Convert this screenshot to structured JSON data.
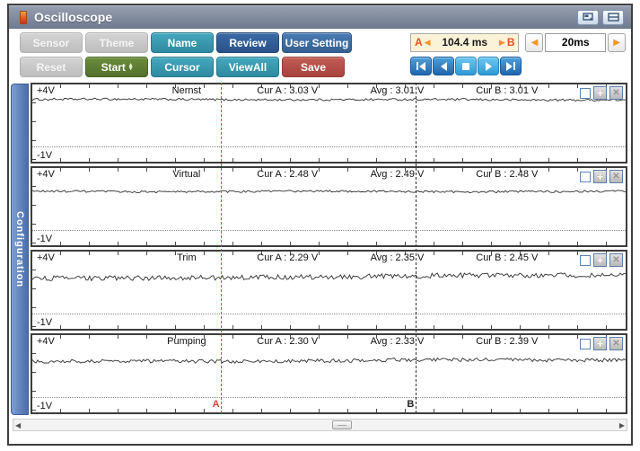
{
  "window": {
    "title": "Oscilloscope"
  },
  "toolbar": {
    "row1": [
      {
        "label": "Sensor",
        "style": "gray"
      },
      {
        "label": "Theme",
        "style": "gray"
      },
      {
        "label": "Name",
        "style": "teal"
      },
      {
        "label": "Review",
        "style": "navy"
      },
      {
        "label": "User Setting",
        "style": "steel"
      }
    ],
    "row2": [
      {
        "label": "Reset",
        "style": "gray"
      },
      {
        "label": "Start",
        "style": "green"
      },
      {
        "label": "Cursor",
        "style": "teal"
      },
      {
        "label": "ViewAll",
        "style": "teal"
      },
      {
        "label": "Save",
        "style": "red"
      }
    ]
  },
  "timebar": {
    "a_label": "A",
    "ab_value": "104.4 ms",
    "b_label": "B",
    "timebase": "20ms"
  },
  "sidebar": {
    "label": "Configuration"
  },
  "channels": [
    {
      "name": "Nernst",
      "top_scale": "+4V",
      "bottom_scale": "-1V",
      "cur_a_label": "Cur A : 3.03 V",
      "avg_label": "Avg : 3.01 V",
      "cur_b_label": "Cur B : 3.01 V",
      "cur_a": 3.03,
      "avg": 3.01,
      "cur_b": 3.01,
      "noise": 0.07
    },
    {
      "name": "Virtual",
      "top_scale": "+4V",
      "bottom_scale": "-1V",
      "cur_a_label": "Cur A : 2.48 V",
      "avg_label": "Avg : 2.49 V",
      "cur_b_label": "Cur B : 2.48 V",
      "cur_a": 2.48,
      "avg": 2.49,
      "cur_b": 2.48,
      "noise": 0.07
    },
    {
      "name": "Trim",
      "top_scale": "+4V",
      "bottom_scale": "-1V",
      "cur_a_label": "Cur A : 2.29 V",
      "avg_label": "Avg : 2.35 V",
      "cur_b_label": "Cur B : 2.45 V",
      "cur_a": 2.29,
      "avg": 2.35,
      "cur_b": 2.45,
      "noise": 0.16
    },
    {
      "name": "Pumping",
      "top_scale": "+4V",
      "bottom_scale": "-1V",
      "cur_a_label": "Cur A : 2.30 V",
      "avg_label": "Avg : 2.33 V",
      "cur_b_label": "Cur B : 2.39 V",
      "cur_a": 2.3,
      "avg": 2.33,
      "cur_b": 2.39,
      "noise": 0.12
    }
  ],
  "cursors": {
    "a_label": "A",
    "b_label": "B",
    "a_pct": 31.9,
    "b_pct": 64.5
  },
  "scale": {
    "v_top": 4,
    "v_bottom": -1
  },
  "colors": {
    "accent_teal": "#2e8aa0",
    "accent_navy": "#2b5288",
    "accent_green": "#51702a",
    "accent_red": "#a8433d",
    "cursor_a": "#e04038",
    "cursor_b": "#333333",
    "tab_blue": "#4a6ea8",
    "ab_box_bg": "#faf3d8"
  },
  "chart_data": [
    {
      "type": "line",
      "title": "Nernst",
      "ylabel": "V",
      "ylim": [
        -1,
        4
      ],
      "cursor_a_v": 3.03,
      "avg_v": 3.01,
      "cursor_b_v": 3.01,
      "cursor_delta": "104.4 ms",
      "time_per_div": "20ms"
    },
    {
      "type": "line",
      "title": "Virtual",
      "ylabel": "V",
      "ylim": [
        -1,
        4
      ],
      "cursor_a_v": 2.48,
      "avg_v": 2.49,
      "cursor_b_v": 2.48,
      "cursor_delta": "104.4 ms",
      "time_per_div": "20ms"
    },
    {
      "type": "line",
      "title": "Trim",
      "ylabel": "V",
      "ylim": [
        -1,
        4
      ],
      "cursor_a_v": 2.29,
      "avg_v": 2.35,
      "cursor_b_v": 2.45,
      "cursor_delta": "104.4 ms",
      "time_per_div": "20ms"
    },
    {
      "type": "line",
      "title": "Pumping",
      "ylabel": "V",
      "ylim": [
        -1,
        4
      ],
      "cursor_a_v": 2.3,
      "avg_v": 2.33,
      "cursor_b_v": 2.39,
      "cursor_delta": "104.4 ms",
      "time_per_div": "20ms"
    }
  ]
}
